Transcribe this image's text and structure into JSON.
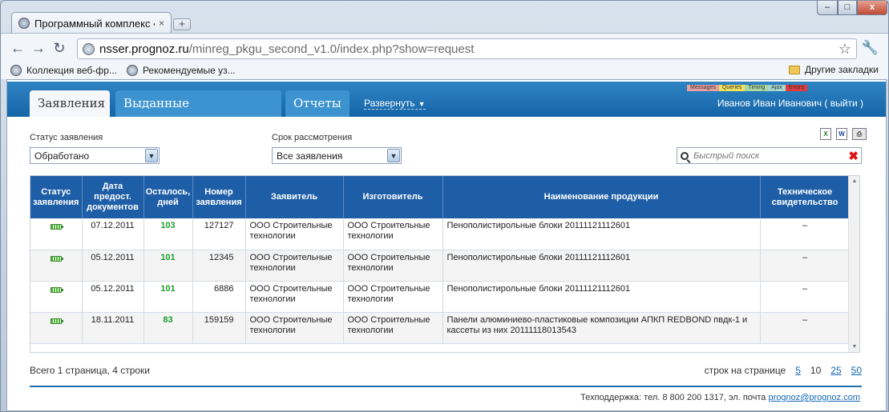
{
  "browser": {
    "tab_title": "Программный комплекс «",
    "url_host": "nsser.prognoz.ru",
    "url_path": "/minreg_pkgu_second_v1.0/index.php?show=request",
    "bookmarks": [
      "Коллекция веб-фр...",
      "Рекомендуемые уз..."
    ],
    "other_bookmarks": "Другие закладки",
    "window_controls": {
      "minimize": "–",
      "maximize": "□",
      "close": "x"
    },
    "new_tab": "+",
    "tab_close": "×",
    "back": "←",
    "forward": "→",
    "reload": "↻",
    "star": "☆",
    "wrench": "🔧"
  },
  "app": {
    "tabs": [
      "Заявления",
      "Выданные свидетельства",
      "Отчеты"
    ],
    "active_tab": "Заявления",
    "expand_label": "Развернуть",
    "expand_caret": "▼",
    "user_text": "Иванов Иван Иванович ( выйти )",
    "debug_bar": [
      {
        "label": "Messages",
        "color": "#e8a0a0"
      },
      {
        "label": "Queries",
        "color": "#f3e25c"
      },
      {
        "label": "Timing",
        "color": "#a8d8a0"
      },
      {
        "label": "Ajax",
        "color": "#a6d7cf"
      },
      {
        "label": "Errors",
        "color": "#e03c3c"
      }
    ]
  },
  "filters": {
    "status_label": "Статус заявления",
    "status_value": "Обработано",
    "term_label": "Срок рассмотрения",
    "term_value": "Все заявления",
    "dropdown_glyph": "▼",
    "search_placeholder": "Быстрый поиск",
    "clear_glyph": "✖",
    "export_icons": {
      "excel": "X",
      "word": "W",
      "print": "⎙"
    }
  },
  "table": {
    "columns": [
      "Статус заявления",
      "Дата предост. документов",
      "Осталось, дней",
      "Номер заявления",
      "Заявитель",
      "Изготовитель",
      "Наименование продукции",
      "Техническое свидетельство"
    ],
    "rows": [
      {
        "date": "07.12.2011",
        "days": "103",
        "number": "127127",
        "applicant": "ООО Строительные технологии",
        "maker": "ООО Строительные технологии",
        "product": "Пенополистирольные блоки 20111121112601",
        "cert": "–"
      },
      {
        "date": "05.12.2011",
        "days": "101",
        "number": "12345",
        "applicant": "ООО Строительные технологии",
        "maker": "ООО Строительные технологии",
        "product": "Пенополистирольные блоки 20111121112601",
        "cert": "–"
      },
      {
        "date": "05.12.2011",
        "days": "101",
        "number": "6886",
        "applicant": "ООО Строительные технологии",
        "maker": "ООО Строительные технологии",
        "product": "Пенополистирольные блоки 20111121112601",
        "cert": "–"
      },
      {
        "date": "18.11.2011",
        "days": "83",
        "number": "159159",
        "applicant": "ООО Строительные технологии",
        "maker": "ООО Строительные технологии",
        "product": "Панели алюминиево-пластиковые композиции АПКП REDBOND пвдк-1 и кассеты из них 20111118013543",
        "cert": "–"
      }
    ],
    "scroll_up": "▲",
    "scroll_down": "▼"
  },
  "pagination": {
    "total": "Всего 1 страница, 4 строки",
    "per_page_label": "строк на странице",
    "options": [
      "5",
      "10",
      "25",
      "50"
    ],
    "current": "10"
  },
  "footer": {
    "support_text": "Техподдержка: тел. 8 800 200 1317, эл. почта",
    "email": "prognoz@prognoz.com"
  }
}
